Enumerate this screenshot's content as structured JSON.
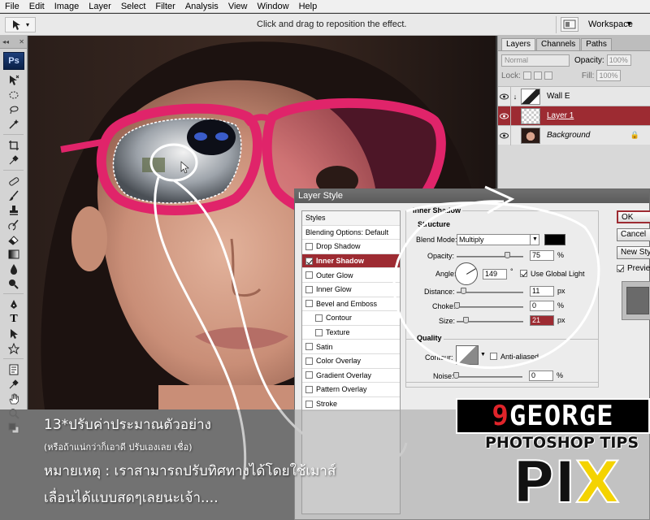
{
  "menubar": {
    "items": [
      "File",
      "Edit",
      "Image",
      "Layer",
      "Select",
      "Filter",
      "Analysis",
      "View",
      "Window",
      "Help"
    ]
  },
  "optionsbar": {
    "hint": "Click and drag to reposition the effect.",
    "workspace_label": "Workspace"
  },
  "tools": {
    "logo": "Ps"
  },
  "layers_panel": {
    "tabs": [
      "Layers",
      "Channels",
      "Paths"
    ],
    "active_tab": "Layers",
    "blend_mode": "Normal",
    "opacity_label": "Opacity:",
    "opacity_value": "100%",
    "lock_label": "Lock:",
    "fill_label": "Fill:",
    "fill_value": "100%",
    "layers": [
      {
        "name": "Wall E",
        "active": false
      },
      {
        "name": "Layer 1",
        "active": true
      },
      {
        "name": "Background",
        "active": false
      }
    ]
  },
  "layer_style": {
    "title": "Layer Style",
    "styles": [
      {
        "label": "Styles",
        "checkbox": false,
        "checked": false,
        "selected": false,
        "indent": false
      },
      {
        "label": "Blending Options: Default",
        "checkbox": false,
        "checked": false,
        "selected": false,
        "indent": false
      },
      {
        "label": "Drop Shadow",
        "checkbox": true,
        "checked": false,
        "selected": false,
        "indent": false
      },
      {
        "label": "Inner Shadow",
        "checkbox": true,
        "checked": true,
        "selected": true,
        "indent": false
      },
      {
        "label": "Outer Glow",
        "checkbox": true,
        "checked": false,
        "selected": false,
        "indent": false
      },
      {
        "label": "Inner Glow",
        "checkbox": true,
        "checked": false,
        "selected": false,
        "indent": false
      },
      {
        "label": "Bevel and Emboss",
        "checkbox": true,
        "checked": false,
        "selected": false,
        "indent": false
      },
      {
        "label": "Contour",
        "checkbox": true,
        "checked": false,
        "selected": false,
        "indent": true
      },
      {
        "label": "Texture",
        "checkbox": true,
        "checked": false,
        "selected": false,
        "indent": true
      },
      {
        "label": "Satin",
        "checkbox": true,
        "checked": false,
        "selected": false,
        "indent": false
      },
      {
        "label": "Color Overlay",
        "checkbox": true,
        "checked": false,
        "selected": false,
        "indent": false
      },
      {
        "label": "Gradient Overlay",
        "checkbox": true,
        "checked": false,
        "selected": false,
        "indent": false
      },
      {
        "label": "Pattern Overlay",
        "checkbox": true,
        "checked": false,
        "selected": false,
        "indent": false
      },
      {
        "label": "Stroke",
        "checkbox": true,
        "checked": false,
        "selected": false,
        "indent": false
      }
    ],
    "inner_shadow": {
      "group_title": "Inner Shadow",
      "structure_title": "Structure",
      "blend_mode_label": "Blend Mode:",
      "blend_mode_value": "Multiply",
      "shadow_color": "#000000",
      "opacity_label": "Opacity:",
      "opacity_value": "75",
      "opacity_fraction": 0.75,
      "angle_label": "Angle:",
      "angle_value": "149",
      "angle_unit": "°",
      "global_light_label": "Use Global Light",
      "global_light_checked": true,
      "distance_label": "Distance:",
      "distance_value": "11",
      "distance_fraction": 0.1,
      "choke_label": "Choke:",
      "choke_value": "0",
      "choke_fraction": 0.0,
      "size_label": "Size:",
      "size_value": "21",
      "size_fraction": 0.14,
      "percent_unit": "%",
      "px_unit": "px"
    },
    "quality": {
      "title": "Quality",
      "contour_label": "Contour:",
      "anti_aliased_label": "Anti-aliased",
      "noise_label": "Noise:",
      "noise_value": "0",
      "noise_fraction": 0.0,
      "percent_unit": "%"
    },
    "buttons": {
      "ok": "OK",
      "cancel": "Cancel",
      "new_style": "New Style...",
      "preview": "Preview"
    }
  },
  "caption": {
    "line1": "13*ปรับค่าประมาณตัวอย่าง",
    "line2": "(หรือถ้าแน่กว่าก็เอาดี ปรับเองเลย เชื่อ)",
    "line3": "หมายเหตุ  :  เราสามารถปรับทิศทางได้โดยใช้เมาส์",
    "line4": "เลื่อนได้แบบสดๆเลยนะเจ้า...."
  },
  "brand": {
    "top_nine": "9",
    "top_rest": "GEORGE",
    "middle": "PHOTOSHOP TIPS",
    "pix_letters": "PI",
    "pix_x": "X"
  },
  "colors": {
    "accent_red": "#9d2b32",
    "glasses_pink": "#e0246a",
    "logo_yellow": "#f4d300"
  }
}
